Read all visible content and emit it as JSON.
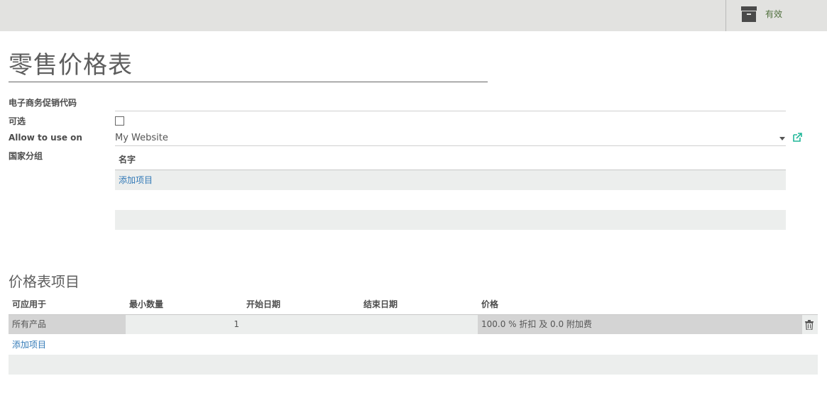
{
  "header": {
    "active_label": "有效",
    "active_icon": "archive-icon"
  },
  "form": {
    "title": "零售价格表",
    "fields": {
      "promo_code_label": "电子商务促销代码",
      "selectable_label": "可选",
      "allow_use_label": "Allow to use on",
      "allow_use_value": "My Website",
      "country_group_label": "国家分组"
    },
    "country_group_table": {
      "header_name": "名字",
      "add_item": "添加项目"
    }
  },
  "pricelist_items": {
    "section_title": "价格表项目",
    "columns": [
      "可应用于",
      "最小数量",
      "开始日期",
      "结束日期",
      "价格"
    ],
    "rows": [
      {
        "applied_on": "所有产品",
        "min_qty": "1",
        "start_date": "",
        "end_date": "",
        "price": "100.0 % 折扣 及 0.0 附加费"
      }
    ],
    "add_item": "添加项目"
  },
  "colors": {
    "link": "#337ab7",
    "active_green": "#4f6f3c",
    "ext_link_green": "#21b799"
  }
}
